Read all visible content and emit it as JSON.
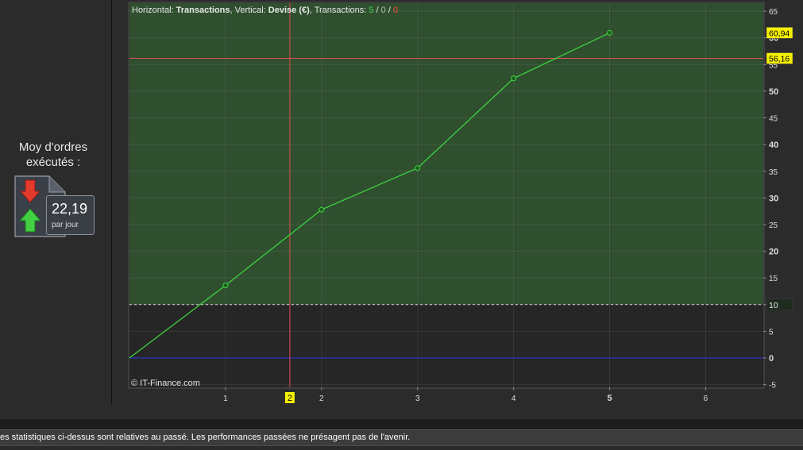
{
  "side_panel": {
    "title": "Moy d'ordres exécutés :",
    "value": "22,19",
    "unit": "par jour"
  },
  "header": {
    "prefix_h": "Horizontal: ",
    "h_name": "Transactions",
    "prefix_v": ", Vertical: ",
    "v_name": "Devise (€)",
    "prefix_t": ", Transactions: ",
    "t_total": "5",
    "sep1": " / ",
    "t_mid": "0",
    "sep2": " / ",
    "t_neg": "0"
  },
  "watermark": "© IT-Finance.com",
  "footer": {
    "disclaimer": "es statistiques ci-dessus sont relatives au passé. Les performances passées ne présagent pas de l'avenir."
  },
  "colors": {
    "positive_zone": "#2f4f2f",
    "negative_zone": "#262626",
    "line": "#3fd23f",
    "ref_line": "#e05050",
    "zero_line": "#3030c0",
    "label_bg": "#f7f100"
  },
  "chart_data": {
    "type": "line",
    "x": [
      0,
      1,
      2,
      3,
      4,
      5
    ],
    "y": [
      0,
      13.6,
      27.8,
      35.6,
      52.4,
      60.94
    ],
    "x_ticks": [
      1,
      2,
      3,
      4,
      5,
      6
    ],
    "y_ticks": [
      -5,
      0,
      5,
      10,
      15,
      20,
      25,
      30,
      35,
      40,
      45,
      50,
      55,
      60,
      65
    ],
    "xlim": [
      0,
      6.6
    ],
    "ylim": [
      -5.5,
      66.5
    ],
    "threshold": 10,
    "threshold_label": "10",
    "reference_y": 56.16,
    "reference_label": "56,16",
    "last_value_label": "60,94",
    "cursor_x": 1.67,
    "cursor_label": "2",
    "grid": true
  }
}
